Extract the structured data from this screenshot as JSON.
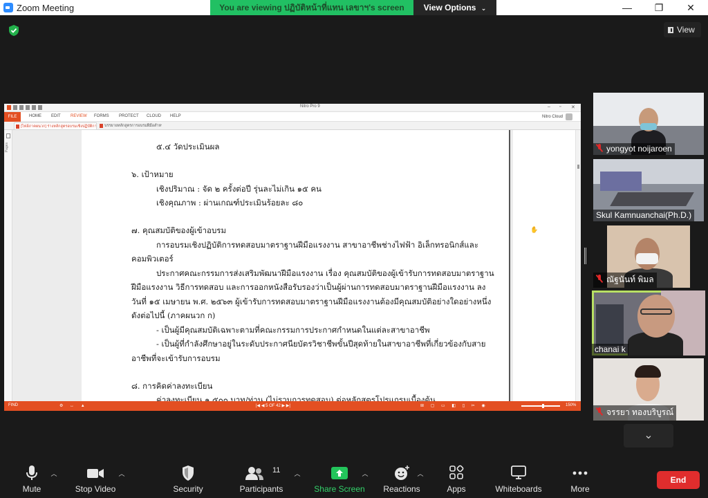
{
  "window": {
    "title": "Zoom Meeting",
    "controls": {
      "minimize": "—",
      "maximize": "❐",
      "close": "✕"
    }
  },
  "banner": {
    "viewing_text": "You are viewing ปฏิบัติหน้าที่แทน เลขาฯ's screen",
    "view_options_label": "View Options"
  },
  "view_button": {
    "label": "View"
  },
  "shared_app": {
    "title": "Nitro Pro 9",
    "file_tab": "FILE",
    "ribbon_tabs": [
      "HOME",
      "EDIT",
      "REVIEW",
      "FORMS",
      "PROTECT",
      "CLOUD",
      "HELP"
    ],
    "cloud_label": "Nitro Cloud",
    "doc_tabs": [
      "[ไฟล์ภาคผนวก] ร่างหลักสูตรอบรมเชิงปฏิบัติการ...",
      "บรรยายหลักสูตรการอบรมฝีมือสำหรับคุณ..."
    ],
    "pages_label": "Pages",
    "status": {
      "find_label": "FIND",
      "pager": "|◀  ◀   5 OF 42   ▶  ▶|",
      "left_tools": "⚙ ↔ ▲",
      "right_tools": "⊞ ▢ ▭ ◧ ▯ ✂ ◉",
      "zoom": "150%"
    },
    "document_lines": [
      "๕.๔ วัดประเมินผล",
      "๖. เป้าหมาย",
      "เชิงปริมาณ : จัด ๒ ครั้งต่อปี รุ่นละไม่เกิน ๑๕ คน",
      "เชิงคุณภาพ : ผ่านเกณฑ์ประเมินร้อยละ ๘๐",
      "๗. คุณสมบัติของผู้เข้าอบรม",
      "การอบรมเชิงปฏิบัติการทดสอบมาตราฐานฝีมือแรงงาน สาขาอาชีพช่างไฟฟ้า อิเล็กทรอนิกส์และ",
      "คอมพิวเตอร์",
      "ประกาศคณะกรรมการส่งเสริมพัฒนาฝีมือแรงงาน เรื่อง คุณสมบัติของผู้เข้ารับการทดสอบมาตราฐาน",
      "ฝีมือแรงงาน วิธีการทดสอบ และการออกหนังสือรับรองว่าเป็นผู้ผ่านการทดสอบมาตราฐานฝีมือแรงงาน ลง",
      "วันที่ ๑๕ เมษายน พ.ศ. ๒๕๖๓ ผู้เข้ารับการทดสอบมาตราฐานฝีมือแรงงานต้องมีคุณสมบัติอย่างใดอย่างหนึ่ง",
      "ดังต่อไปนี้ (ภาคผนวก ก)",
      "- เป็นผู้มีคุณสมบัติเฉพาะตามที่คณะกรรมการประกาศกำหนดในแต่ละสาขาอาชีพ",
      "- เป็นผู้ที่กำลังศึกษาอยู่ในระดับประกาศนียบัตรวิชาชีพขั้นปีสุดท้ายในสาขาอาชีพที่เกี่ยวข้องกับสาย",
      "อาชีพที่จะเข้ารับการอบรม",
      "๘. การคิดค่าลงทะเบียน",
      "ค่าลงทะเบียน ๑,๕๐๐ บาท/ท่าน (ไม่รวมการทดสอบ) ต่อหลักสูตรโปรแกรมเบื้องต้น"
    ]
  },
  "participants_panel": [
    {
      "name": "yongyot noijaroen",
      "muted": true
    },
    {
      "name": "Skul Kamnuanchai(Ph.D.)",
      "muted": false
    },
    {
      "name": "ณัฐนันท์  พิมล",
      "muted": true
    },
    {
      "name": "chanai k",
      "muted": false,
      "active_speaker": true
    },
    {
      "name": "จรรยา ทองบริบูรณ์",
      "muted": true
    }
  ],
  "panel_scroll_icon": "⌄",
  "toolbar": {
    "mute": "Mute",
    "stop_video": "Stop Video",
    "security": "Security",
    "participants": "Participants",
    "participants_count": "11",
    "share_screen": "Share Screen",
    "reactions": "Reactions",
    "apps": "Apps",
    "whiteboards": "Whiteboards",
    "more": "More",
    "end": "End"
  },
  "colors": {
    "banner_green": "#21c063",
    "share_green": "#33d26a",
    "end_red": "#e02d2d",
    "nitro_orange": "#e34f22",
    "active_speaker": "#b8e063",
    "zoom_blue": "#2d8cff"
  }
}
